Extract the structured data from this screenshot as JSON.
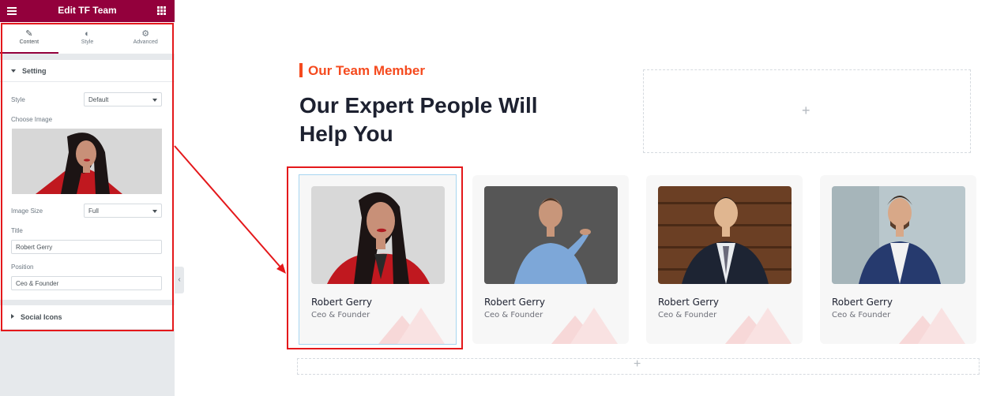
{
  "panel": {
    "title": "Edit TF Team",
    "tabs": [
      {
        "label": "Content",
        "icon": "pencil-icon",
        "active": true
      },
      {
        "label": "Style",
        "icon": "half-circle-icon",
        "active": false
      },
      {
        "label": "Advanced",
        "icon": "gear-icon",
        "active": false
      }
    ],
    "setting": {
      "heading": "Setting",
      "style_label": "Style",
      "style_value": "Default",
      "choose_image_label": "Choose Image",
      "image_size_label": "Image Size",
      "image_size_value": "Full",
      "title_label": "Title",
      "title_value": "Robert Gerry",
      "position_label": "Position",
      "position_value": "Ceo & Founder"
    },
    "social_heading": "Social Icons",
    "accent_color": "#93003c"
  },
  "canvas": {
    "subtitle": "Our Team Member",
    "heading_line1": "Our Expert People Will",
    "heading_line2": "Help You",
    "accent_color": "#f54a1e",
    "team": [
      {
        "name": "Robert Gerry",
        "position": "Ceo & Founder"
      },
      {
        "name": "Robert Gerry",
        "position": "Ceo & Founder"
      },
      {
        "name": "Robert Gerry",
        "position": "Ceo & Founder"
      },
      {
        "name": "Robert Gerry",
        "position": "Ceo & Founder"
      }
    ]
  }
}
